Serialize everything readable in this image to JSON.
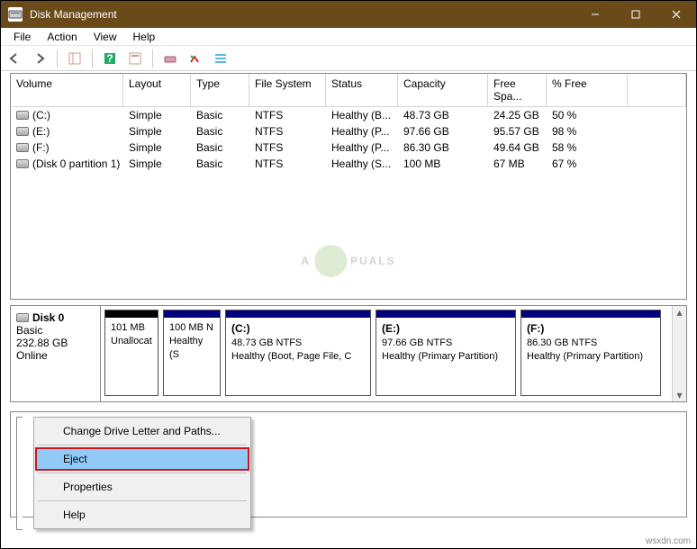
{
  "window": {
    "title": "Disk Management"
  },
  "menu": {
    "file": "File",
    "action": "Action",
    "view": "View",
    "help": "Help"
  },
  "columns": {
    "volume": "Volume",
    "layout": "Layout",
    "type": "Type",
    "fs": "File System",
    "status": "Status",
    "capacity": "Capacity",
    "free": "Free Spa...",
    "pct": "% Free"
  },
  "volumes": [
    {
      "name": "(C:)",
      "layout": "Simple",
      "type": "Basic",
      "fs": "NTFS",
      "status": "Healthy (B...",
      "capacity": "48.73 GB",
      "free": "24.25 GB",
      "pct": "50 %"
    },
    {
      "name": "(E:)",
      "layout": "Simple",
      "type": "Basic",
      "fs": "NTFS",
      "status": "Healthy (P...",
      "capacity": "97.66 GB",
      "free": "95.57 GB",
      "pct": "98 %"
    },
    {
      "name": "(F:)",
      "layout": "Simple",
      "type": "Basic",
      "fs": "NTFS",
      "status": "Healthy (P...",
      "capacity": "86.30 GB",
      "free": "49.64 GB",
      "pct": "58 %"
    },
    {
      "name": "(Disk 0 partition 1)",
      "layout": "Simple",
      "type": "Basic",
      "fs": "NTFS",
      "status": "Healthy (S...",
      "capacity": "100 MB",
      "free": "67 MB",
      "pct": "67 %"
    }
  ],
  "disk": {
    "name": "Disk 0",
    "type": "Basic",
    "size": "232.88 GB",
    "state": "Online",
    "partitions": [
      {
        "line1": "",
        "line2": "101 MB",
        "line3": "Unallocat",
        "width": 60,
        "unalloc": true
      },
      {
        "line1": "",
        "line2": "100 MB N",
        "line3": "Healthy (S",
        "width": 64,
        "unalloc": false
      },
      {
        "line1": "(C:)",
        "line2": "48.73 GB NTFS",
        "line3": "Healthy (Boot, Page File, C",
        "width": 162,
        "unalloc": false
      },
      {
        "line1": "(E:)",
        "line2": "97.66 GB NTFS",
        "line3": "Healthy (Primary Partition)",
        "width": 156,
        "unalloc": false
      },
      {
        "line1": "(F:)",
        "line2": "86.30 GB NTFS",
        "line3": "Healthy (Primary Partition)",
        "width": 156,
        "unalloc": false
      }
    ]
  },
  "context": {
    "change": "Change Drive Letter and Paths...",
    "eject": "Eject",
    "properties": "Properties",
    "help": "Help"
  },
  "watermark": {
    "left": "A",
    "right": "PUALS"
  },
  "footer": "wsxdn.com"
}
